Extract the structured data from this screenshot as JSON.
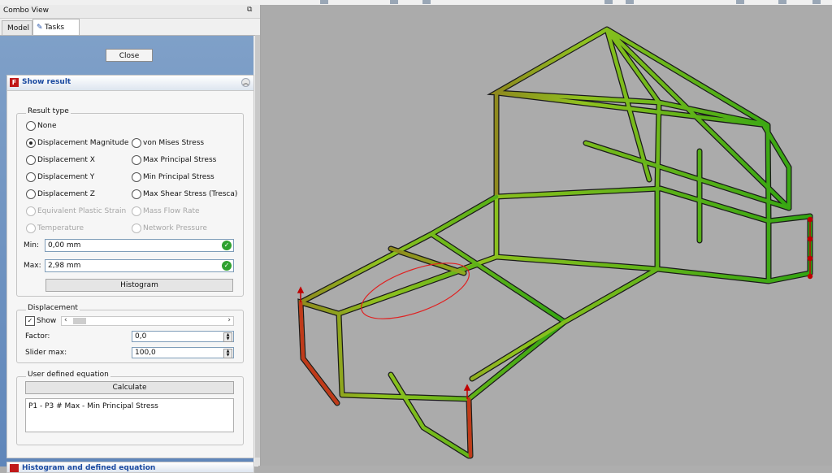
{
  "combo_view": {
    "title": "Combo View",
    "tabs": [
      "Model",
      "Tasks"
    ]
  },
  "tasks": {
    "close_label": "Close",
    "panel_title": "Show result",
    "result_type": {
      "group_label": "Result type",
      "options": [
        {
          "label": "None",
          "checked": false,
          "enabled": true
        },
        {
          "label": "Displacement Magnitude",
          "checked": true,
          "enabled": true
        },
        {
          "label": "Displacement X",
          "checked": false,
          "enabled": true
        },
        {
          "label": "Displacement Y",
          "checked": false,
          "enabled": true
        },
        {
          "label": "Displacement Z",
          "checked": false,
          "enabled": true
        },
        {
          "label": "Equivalent Plastic Strain",
          "checked": false,
          "enabled": false
        },
        {
          "label": "Temperature",
          "checked": false,
          "enabled": false
        },
        {
          "label": "von Mises Stress",
          "checked": false,
          "enabled": true
        },
        {
          "label": "Max Principal Stress",
          "checked": false,
          "enabled": true
        },
        {
          "label": "Min Principal Stress",
          "checked": false,
          "enabled": true
        },
        {
          "label": "Max Shear Stress (Tresca)",
          "checked": false,
          "enabled": true
        },
        {
          "label": "Mass Flow Rate",
          "checked": false,
          "enabled": false
        },
        {
          "label": "Network Pressure",
          "checked": false,
          "enabled": false
        }
      ]
    },
    "min_label": "Min:",
    "min_value": "0,00 mm",
    "max_label": "Max:",
    "max_value": "2,98 mm",
    "histogram_label": "Histogram",
    "displacement": {
      "group_label": "Displacement",
      "show_label": "Show",
      "show_checked": true,
      "factor_label": "Factor:",
      "factor_value": "0,0",
      "slider_max_label": "Slider max:",
      "slider_max_value": "100,0"
    },
    "equation": {
      "group_label": "User defined equation",
      "calculate_label": "Calculate",
      "text": "P1 - P3 # Max - Min Principal Stress"
    },
    "next_panel_title": "Histogram and defined equation"
  }
}
